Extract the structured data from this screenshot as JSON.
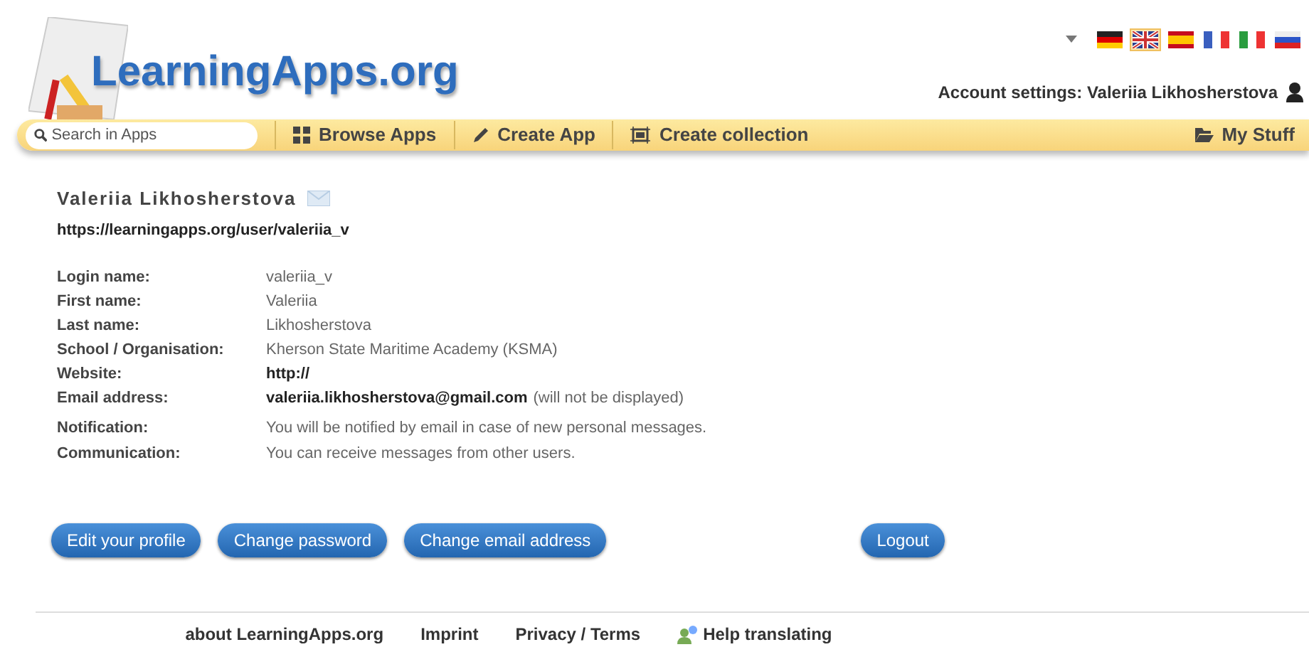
{
  "logo": {
    "text": "LearningApps.org"
  },
  "languages": [
    {
      "kind": "de",
      "selected": false
    },
    {
      "kind": "gb",
      "selected": true
    },
    {
      "kind": "es",
      "selected": false
    },
    {
      "kind": "fr",
      "selected": false
    },
    {
      "kind": "it",
      "selected": false
    },
    {
      "kind": "ru",
      "selected": false
    }
  ],
  "account": {
    "label": "Account settings: Valeriia Likhosherstova"
  },
  "nav": {
    "search": {
      "placeholder": "Search in Apps"
    },
    "items": [
      {
        "kind": "grid",
        "label": "Browse Apps"
      },
      {
        "kind": "pencil",
        "label": "Create App"
      },
      {
        "kind": "frame",
        "label": "Create collection"
      }
    ],
    "my_stuff": "My Stuff"
  },
  "profile": {
    "name": "Valeriia Likhosherstova",
    "url": "https://learningapps.org/user/valeriia_v",
    "fields": [
      {
        "label": "Login name:",
        "value": "valeriia_v",
        "bold": false
      },
      {
        "label": "First name:",
        "value": "Valeriia",
        "bold": false
      },
      {
        "label": "Last name:",
        "value": "Likhosherstova",
        "bold": false
      },
      {
        "label": "School / Organisation:",
        "value": "Kherson State Maritime Academy (KSMA)",
        "bold": false
      },
      {
        "label": "Website:",
        "value": "http://",
        "bold": true
      },
      {
        "label": "Email address:",
        "value": "valeriia.likhosherstova@gmail.com",
        "bold": true,
        "note": "(will not be displayed)"
      }
    ],
    "settings": [
      {
        "label": "Notification:",
        "value": "You will be notified by email in case of new personal messages."
      },
      {
        "label": "Communication:",
        "value": "You can receive messages from other users."
      }
    ]
  },
  "buttons": [
    "Edit your profile",
    "Change password",
    "Change email address"
  ],
  "logout": "Logout",
  "footer": [
    "about LearningApps.org",
    "Imprint",
    "Privacy / Terms"
  ],
  "help": "Help translating"
}
